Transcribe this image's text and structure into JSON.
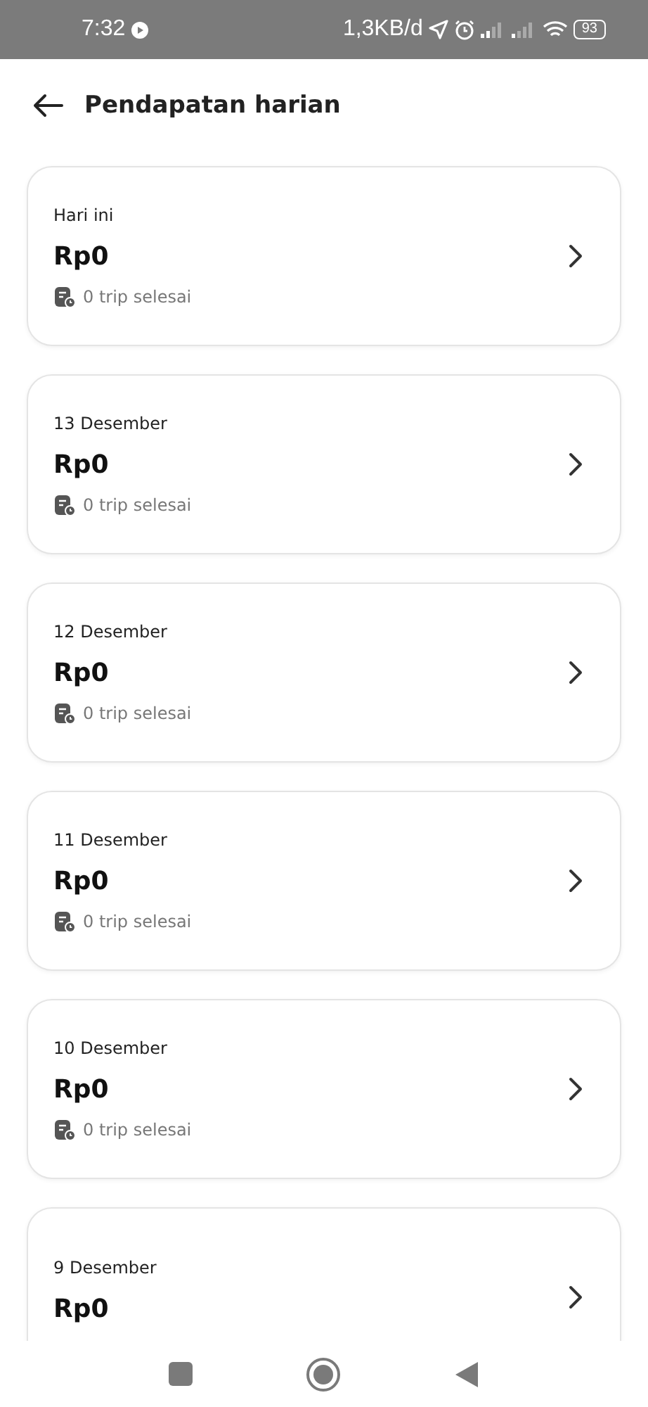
{
  "status_bar": {
    "time": "7:32",
    "network_speed": "1,3KB/d",
    "battery": "93"
  },
  "header": {
    "title": "Pendapatan harian"
  },
  "days": [
    {
      "date": "Hari ini",
      "amount": "Rp0",
      "trips": "0 trip selesai"
    },
    {
      "date": "13 Desember",
      "amount": "Rp0",
      "trips": "0 trip selesai"
    },
    {
      "date": "12 Desember",
      "amount": "Rp0",
      "trips": "0 trip selesai"
    },
    {
      "date": "11 Desember",
      "amount": "Rp0",
      "trips": "0 trip selesai"
    },
    {
      "date": "10 Desember",
      "amount": "Rp0",
      "trips": "0 trip selesai"
    },
    {
      "date": "9 Desember",
      "amount": "Rp0"
    }
  ]
}
